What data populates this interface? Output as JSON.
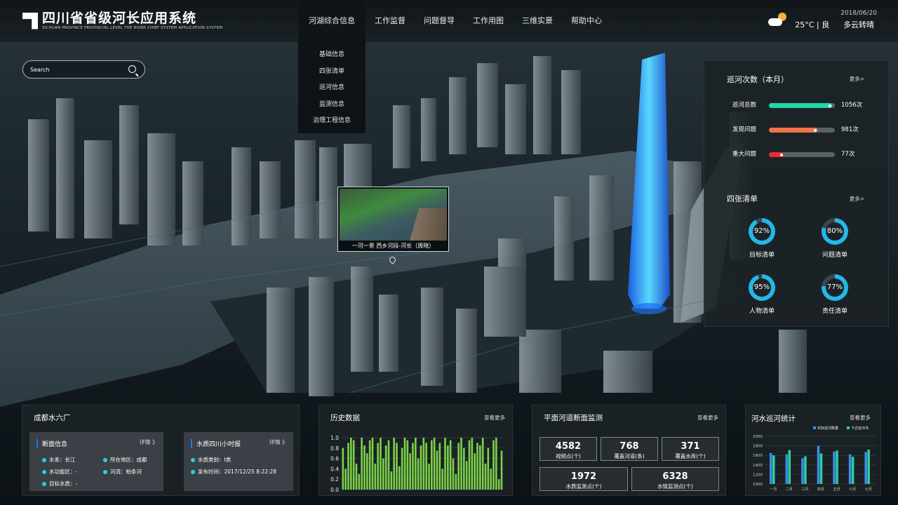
{
  "app": {
    "title": "四川省省级河长应用系统",
    "subtitle": "SICHUAN PROVINCE PROVINCIAL LEVEL THE RIVER CHIEF SYSTEM APPLICATION SYSTEM"
  },
  "nav": [
    "河湖综合信息",
    "工作监督",
    "问题督导",
    "工作用图",
    "三维实景",
    "帮助中心"
  ],
  "dropdown": [
    "基础信息",
    "四张清单",
    "巡河信息",
    "监测信息",
    "治理工程信息"
  ],
  "weather": {
    "temp": "25°C | 良",
    "date": "2018/06/20",
    "condition": "多云转晴"
  },
  "search": {
    "placeholder": "Search"
  },
  "popup": {
    "caption": "一河一景 西乡河段-河长（周晓）"
  },
  "patrol": {
    "title": "巡河次数（本月）",
    "more": "更多>",
    "rows": [
      {
        "label": "巡河总数",
        "value": "1056次",
        "ratio": 0.96,
        "color": "#22d6a6"
      },
      {
        "label": "发现问题",
        "value": "981次",
        "ratio": 0.73,
        "color": "#f2734a"
      },
      {
        "label": "重大问题",
        "value": "77次",
        "ratio": 0.22,
        "color": "#ee2b32"
      }
    ]
  },
  "lists": {
    "title": "四张清单",
    "more": "更多>",
    "items": [
      {
        "label": "目标清单",
        "pct": "92%",
        "value": 92
      },
      {
        "label": "问题清单",
        "pct": "80%",
        "value": 80
      },
      {
        "label": "人物清单",
        "pct": "95%",
        "value": 95
      },
      {
        "label": "责任清单",
        "pct": "77%",
        "value": 77
      }
    ]
  },
  "plant": {
    "title": "成都水六厂",
    "section": {
      "title": "断面信息",
      "detail": "详情 》",
      "fields": [
        "水系：长江",
        "所在地区：成都",
        "水功能区：-",
        "河流：柏条河",
        "目标水质：-"
      ]
    },
    "quality": {
      "title": "水质四川小时报",
      "detail": "详情 》",
      "fields": [
        "水质类别：Ⅰ类",
        "发布时间：2017/12/25 8:22:28"
      ]
    }
  },
  "history": {
    "title": "历史数据",
    "more": "查看更多"
  },
  "section_monitor": {
    "title": "平面河道断面监测",
    "more": "查看更多",
    "stats": [
      {
        "n": "4582",
        "l": "视频点(个)"
      },
      {
        "n": "768",
        "l": "覆盖河道(条)"
      },
      {
        "n": "371",
        "l": "覆盖水库(个)"
      },
      {
        "n": "1972",
        "l": "水质监测点(个)"
      },
      {
        "n": "6328",
        "l": "水情监测点(个)"
      }
    ]
  },
  "patrol_stats": {
    "title": "河水巡河统计",
    "more": "查看更多"
  },
  "colors": {
    "green": "#7bd049",
    "blue": "#3a8ee6",
    "teal": "#2ad1d8",
    "cyan": "#23b8e8"
  },
  "chart_data": [
    {
      "type": "bar",
      "title": "历史数据",
      "ylim": [
        0,
        1.0
      ],
      "yticks": [
        "0.0",
        "0.2",
        "0.4",
        "0.6",
        "0.8",
        "1.0"
      ],
      "values": [
        0.8,
        0.4,
        0.9,
        1.0,
        0.95,
        0.5,
        0.3,
        1.0,
        0.85,
        0.7,
        0.95,
        1.0,
        0.5,
        0.9,
        1.0,
        0.6,
        0.85,
        0.95,
        0.35,
        1.0,
        0.9,
        0.45,
        0.8,
        1.0,
        0.95,
        0.7,
        0.9,
        1.0,
        0.6,
        0.85,
        1.0,
        0.9,
        0.5,
        0.95,
        1.0,
        0.75,
        0.9,
        0.4,
        1.0,
        0.85,
        0.95,
        0.6,
        0.3,
        0.9,
        1.0,
        0.8,
        0.55,
        0.95,
        1.0,
        0.7,
        0.9,
        0.85,
        1.0,
        0.5,
        0.8,
        0.4,
        0.95,
        1.0,
        0.2,
        0.75
      ],
      "color": "#7bd049"
    },
    {
      "type": "bar",
      "title": "河水巡河统计",
      "categories": [
        "一月",
        "二月",
        "三月",
        "四月",
        "五月",
        "六月",
        "七月"
      ],
      "ylim": [
        1000,
        2000
      ],
      "yticks": [
        "1000",
        "1200",
        "1400",
        "1600",
        "1800",
        "2000"
      ],
      "legend": [
        "实际巡河数量",
        "下达巡河书"
      ],
      "series": [
        {
          "name": "实际巡河数量",
          "values": [
            1650,
            1620,
            1540,
            1800,
            1680,
            1620,
            1670
          ],
          "color": "#3a8ee6"
        },
        {
          "name": "下达巡河书",
          "values": [
            1600,
            1710,
            1580,
            1640,
            1700,
            1570,
            1720
          ],
          "color": "#2ad1a0"
        }
      ]
    }
  ]
}
